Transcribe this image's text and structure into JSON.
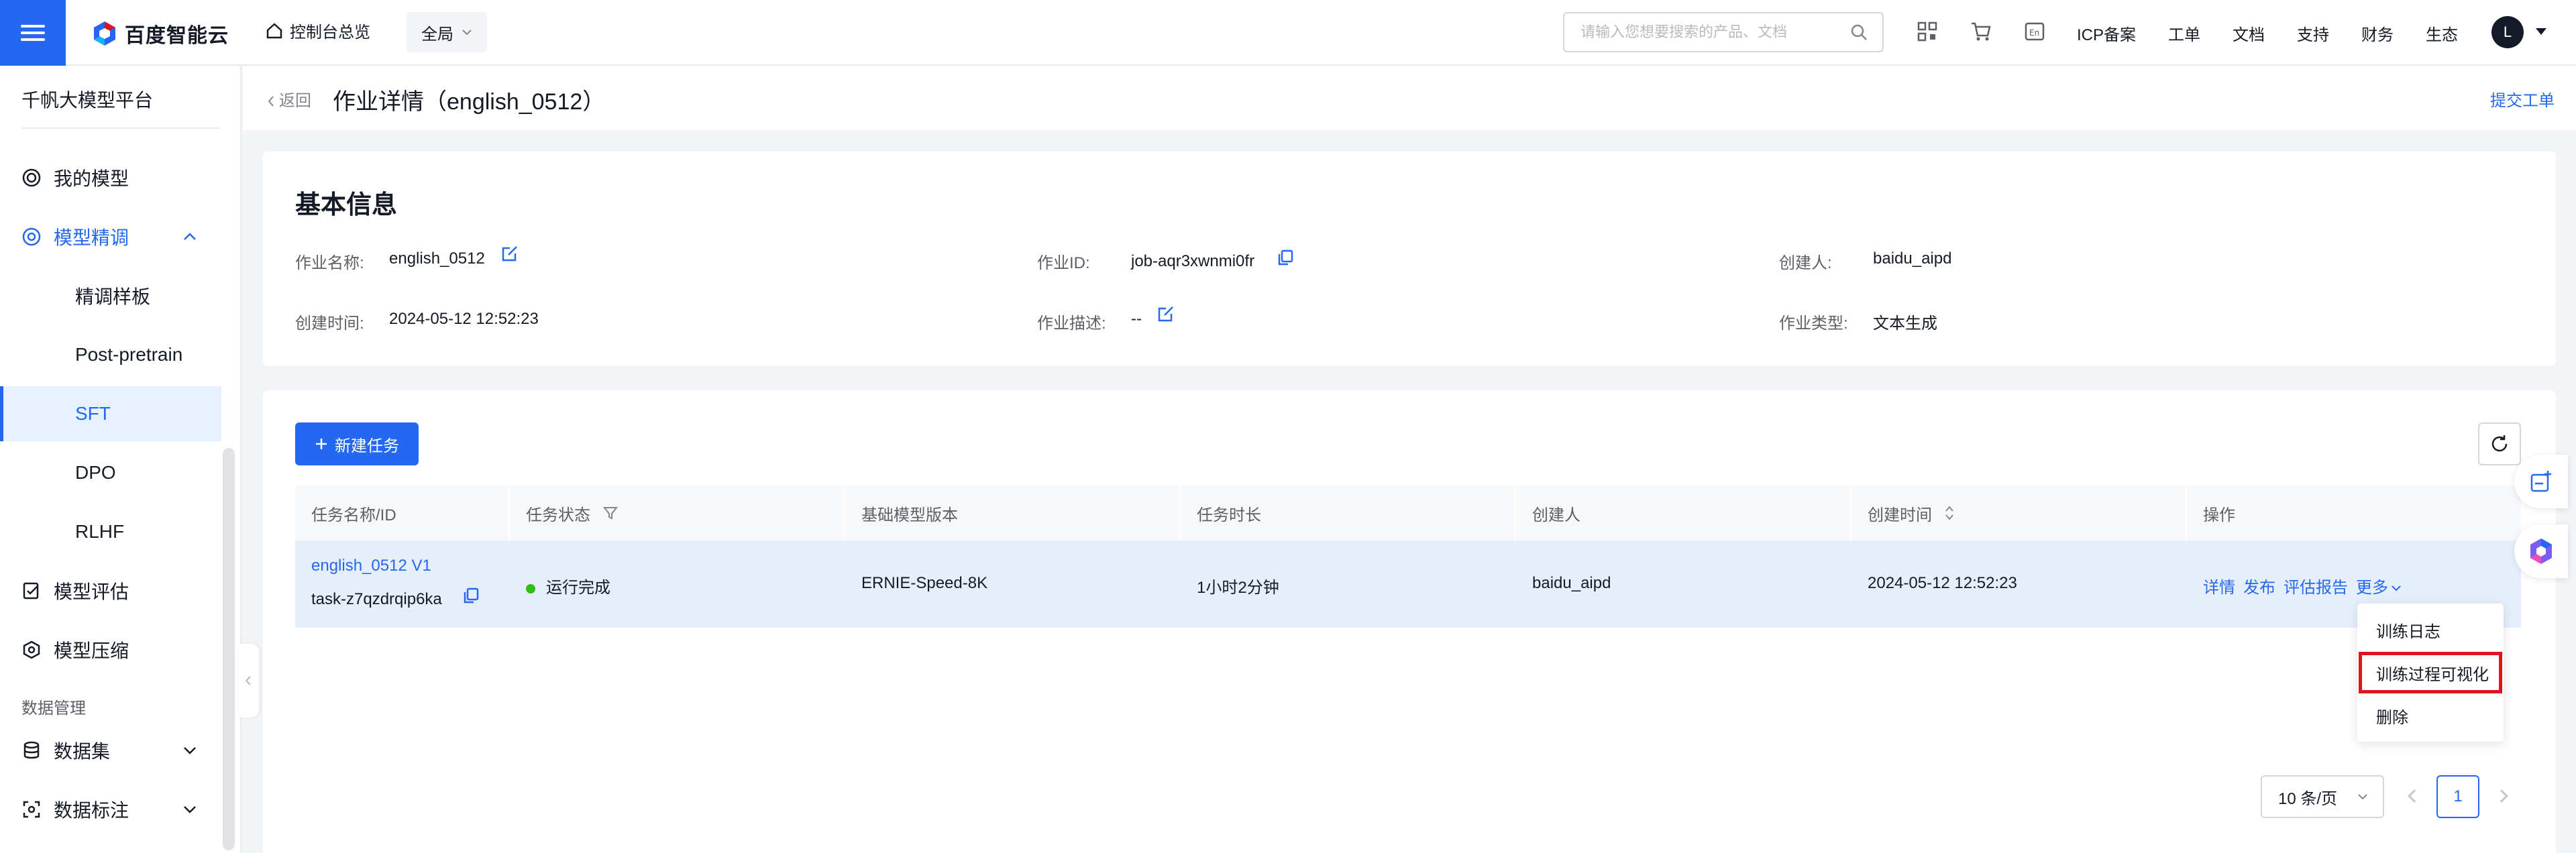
{
  "topbar": {
    "logo_text": "百度智能云",
    "console_label": "控制台总览",
    "region_label": "全局",
    "search_placeholder": "请输入您想要搜索的产品、文档",
    "links": [
      "ICP备案",
      "工单",
      "文档",
      "支持",
      "财务",
      "生态"
    ],
    "avatar_letter": "L"
  },
  "sidebar": {
    "title": "千帆大模型平台",
    "items": [
      {
        "label": "我的模型"
      },
      {
        "label": "模型精调"
      },
      {
        "label": "精调样板"
      },
      {
        "label": "Post-pretrain"
      },
      {
        "label": "SFT"
      },
      {
        "label": "DPO"
      },
      {
        "label": "RLHF"
      },
      {
        "label": "模型评估"
      },
      {
        "label": "模型压缩"
      }
    ],
    "section_label": "数据管理",
    "data_items": [
      {
        "label": "数据集"
      },
      {
        "label": "数据标注"
      }
    ]
  },
  "header": {
    "back_label": "返回",
    "title": "作业详情（english_0512）",
    "submit_ticket": "提交工单"
  },
  "info": {
    "title": "基本信息",
    "job_name_label": "作业名称:",
    "job_name": "english_0512",
    "job_id_label": "作业ID:",
    "job_id": "job-aqr3xwnmi0fr",
    "creator_label": "创建人:",
    "creator": "baidu_aipd",
    "created_time_label": "创建时间:",
    "created_time": "2024-05-12 12:52:23",
    "desc_label": "作业描述:",
    "desc": "--",
    "type_label": "作业类型:",
    "type": "文本生成"
  },
  "tasks": {
    "new_task_label": "新建任务",
    "columns": [
      "任务名称/ID",
      "任务状态",
      "基础模型版本",
      "任务时长",
      "创建人",
      "创建时间",
      "操作"
    ],
    "rows": [
      {
        "name": "english_0512 V1",
        "id": "task-z7qzdrqip6ka",
        "status": "运行完成",
        "base_model": "ERNIE-Speed-8K",
        "duration": "1小时2分钟",
        "creator": "baidu_aipd",
        "created_time": "2024-05-12 12:52:23",
        "actions": [
          "详情",
          "发布",
          "评估报告",
          "更多"
        ]
      }
    ],
    "more_menu": [
      "训练日志",
      "训练过程可视化",
      "删除"
    ]
  },
  "pagination": {
    "page_size": "10 条/页",
    "current_page": "1"
  },
  "colors": {
    "primary": "#2468f2",
    "status_ok": "#30bf13",
    "highlight": "#e0141e"
  }
}
